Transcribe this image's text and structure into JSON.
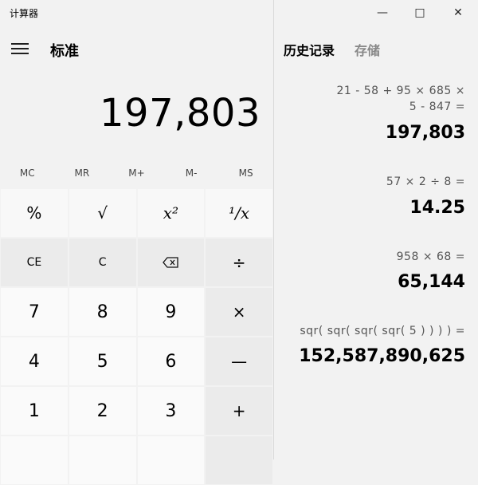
{
  "app": {
    "title": "计算器"
  },
  "header": {
    "mode": "标准"
  },
  "display": {
    "value": "197,803"
  },
  "memory": [
    "MC",
    "MR",
    "M+",
    "M-",
    "MS"
  ],
  "keys": {
    "row1": [
      "%",
      "√",
      "x²",
      "¹/x"
    ],
    "row2": [
      "CE",
      "C",
      "⌫",
      "÷"
    ],
    "row3": [
      "7",
      "8",
      "9",
      "×"
    ],
    "row4": [
      "4",
      "5",
      "6",
      "—"
    ],
    "row5": [
      "1",
      "2",
      "3",
      "+"
    ]
  },
  "window_controls": {
    "minimize": "—",
    "maximize": "□",
    "close": "✕"
  },
  "tabs": {
    "history": "历史记录",
    "memory": "存储"
  },
  "history": [
    {
      "expr_line1": "21 - 58 + 95 × 685 ×",
      "expr_line2": "5 - 847 =",
      "result": "197,803"
    },
    {
      "expr_line1": "57 × 2 ÷ 8 =",
      "result": "14.25"
    },
    {
      "expr_line1": "958 × 68 =",
      "result": "65,144"
    },
    {
      "expr_line1": "sqr( sqr( sqr( sqr( 5 ) ) ) ) =",
      "result": "152,587,890,625"
    }
  ]
}
